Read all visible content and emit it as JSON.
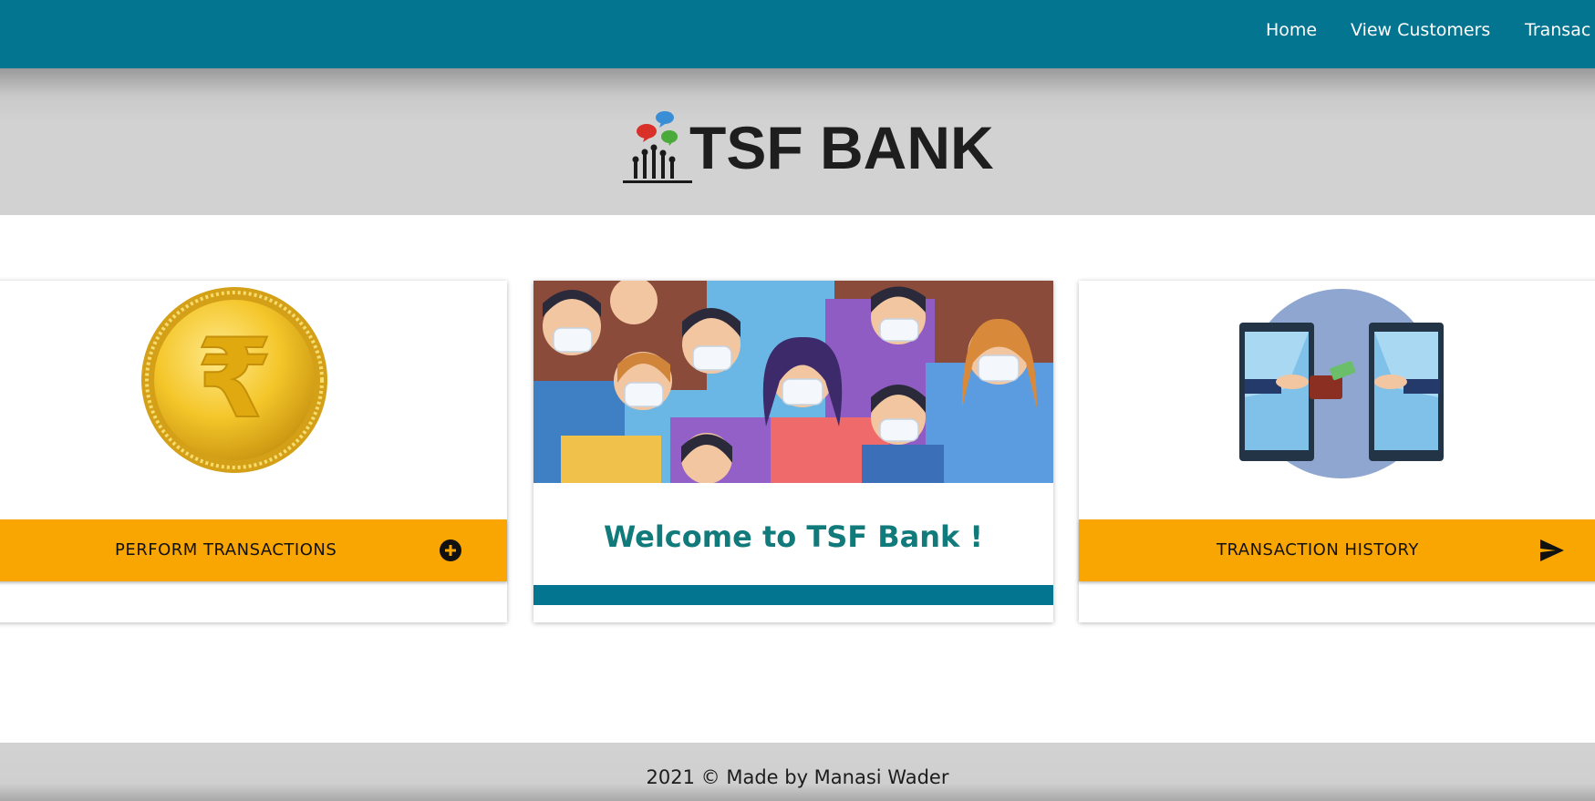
{
  "nav": {
    "items": [
      {
        "label": "Home"
      },
      {
        "label": "View Customers"
      },
      {
        "label": "Transac"
      }
    ]
  },
  "header": {
    "brand": "TSF BANK",
    "logo_icon": "people-speech-bubbles-logo"
  },
  "cards": {
    "left": {
      "image_icon": "rupee-coin-icon",
      "action_label": "PERFORM TRANSACTIONS",
      "action_icon": "plus-circle-icon"
    },
    "middle": {
      "image_icon": "masked-crowd-illustration",
      "welcome_text": "Welcome to TSF Bank !"
    },
    "right": {
      "image_icon": "phone-money-transfer-illustration",
      "action_label": "TRANSACTION HISTORY",
      "action_icon": "send-arrow-icon"
    }
  },
  "footer": {
    "text": "2021 © Made by Manasi Wader"
  },
  "colors": {
    "nav": "#037591",
    "accent": "#f9a602",
    "welcome": "#117a7a"
  }
}
